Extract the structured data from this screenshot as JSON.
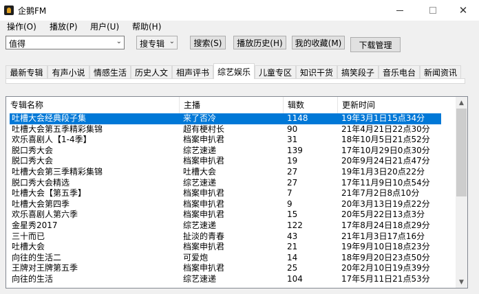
{
  "window": {
    "title": "企鹅FM"
  },
  "menu": [
    "操作(O)",
    "播放(P)",
    "用户(U)",
    "帮助(H)"
  ],
  "toolbar": {
    "query_value": "值得",
    "mode_value": "搜专辑",
    "search_label": "搜索(S)",
    "history_label": "播放历史(H)",
    "favorites_label": "我的收藏(M)",
    "download_label": "下载管理"
  },
  "tabs": [
    "最新专辑",
    "有声小说",
    "情感生活",
    "历史人文",
    "相声评书",
    "综艺娱乐",
    "儿童专区",
    "知识干货",
    "搞笑段子",
    "音乐电台",
    "新闻资讯"
  ],
  "active_tab": "综艺娱乐",
  "table": {
    "columns": [
      "专辑名称",
      "主播",
      "辑数",
      "更新时间"
    ],
    "rows": [
      [
        "吐槽大会经典段子集",
        "来了否冷",
        "1148",
        "19年3月1日15点34分"
      ],
      [
        "吐槽大会第五季精彩集锦",
        "超有梗村长",
        "90",
        "21年4月21日22点30分"
      ],
      [
        "欢乐喜剧人【1-4季】",
        "档案申扒君",
        "31",
        "18年10月5日21点52分"
      ],
      [
        "脱口秀大会",
        "综艺速递",
        "139",
        "17年10月29日0点30分"
      ],
      [
        "脱口秀大会",
        "档案申扒君",
        "19",
        "20年9月24日21点47分"
      ],
      [
        "吐槽大会第三季精彩集锦",
        "吐槽大会",
        "27",
        "19年1月3日20点22分"
      ],
      [
        "脱口秀大会精选",
        "综艺速递",
        "27",
        "17年11月9日10点54分"
      ],
      [
        "吐槽大会【第五季】",
        "档案申扒君",
        "7",
        "21年7月2日8点10分"
      ],
      [
        "吐槽大会第四季",
        "档案申扒君",
        "9",
        "20年3月13日19点22分"
      ],
      [
        "欢乐喜剧人第六季",
        "档案申扒君",
        "15",
        "20年5月22日13点3分"
      ],
      [
        "金星秀2017",
        "综艺速递",
        "122",
        "17年8月24日18点29分"
      ],
      [
        "三十而已",
        "扯淡的青春",
        "43",
        "21年1月3日17点16分"
      ],
      [
        "吐槽大会",
        "档案申扒君",
        "21",
        "19年9月10日18点23分"
      ],
      [
        "向往的生活二",
        "可爱炮",
        "14",
        "18年9月20日23点50分"
      ],
      [
        "王牌对王牌第五季",
        "档案申扒君",
        "25",
        "20年2月10日19点39分"
      ],
      [
        "向往的生活",
        "综艺速递",
        "104",
        "17年5月11日21点53分"
      ]
    ],
    "selected_row": 0
  },
  "icons": {
    "app": "penguin-app-icon",
    "minimize": "minimize-icon",
    "maximize": "maximize-icon",
    "close": "close-icon",
    "dropdown": "chevron-down-icon",
    "scroll_up": "scroll-up-arrow-icon",
    "scroll_down": "scroll-down-arrow-icon"
  },
  "colors": {
    "selection": "#0078d7",
    "window_bg": "#f0f0f0"
  }
}
